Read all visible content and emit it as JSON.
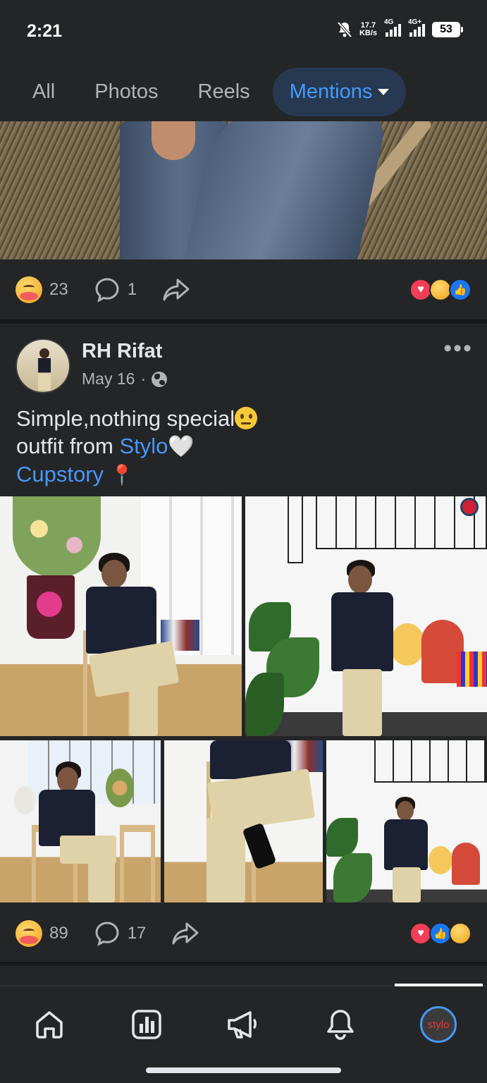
{
  "status_bar": {
    "time": "2:21",
    "net_speed_value": "17.7",
    "net_speed_unit": "KB/s",
    "signal1_label": "4G",
    "signal2_label": "4G+",
    "battery": "53",
    "icons": [
      "bell-off-icon",
      "signal-icon",
      "battery-icon"
    ]
  },
  "tabs": [
    {
      "label": "All"
    },
    {
      "label": "Photos"
    },
    {
      "label": "Reels"
    },
    {
      "label": "Mentions"
    }
  ],
  "previous_post": {
    "reaction_count": "23",
    "comment_count": "1",
    "reaction_icons": [
      "love",
      "care",
      "like"
    ]
  },
  "post": {
    "author": "RH Rifat",
    "date": "May 16",
    "separator": "·",
    "privacy_icon": "globe-icon",
    "caption_line1": "Simple,nothing special",
    "caption_line2_prefix": "outfit from ",
    "caption_tag1": "Stylo",
    "caption_tag2": "Cupstory",
    "reaction_count": "89",
    "comment_count": "17",
    "reaction_icons": [
      "love",
      "like",
      "care"
    ]
  },
  "bottom_nav": {
    "items": [
      "home-icon",
      "dashboard-icon",
      "megaphone-icon",
      "bell-icon",
      "profile-avatar"
    ],
    "profile_label": "stylo"
  },
  "colors": {
    "background": "#242526",
    "accent": "#4599ff",
    "active_tab_bg": "#263951"
  }
}
